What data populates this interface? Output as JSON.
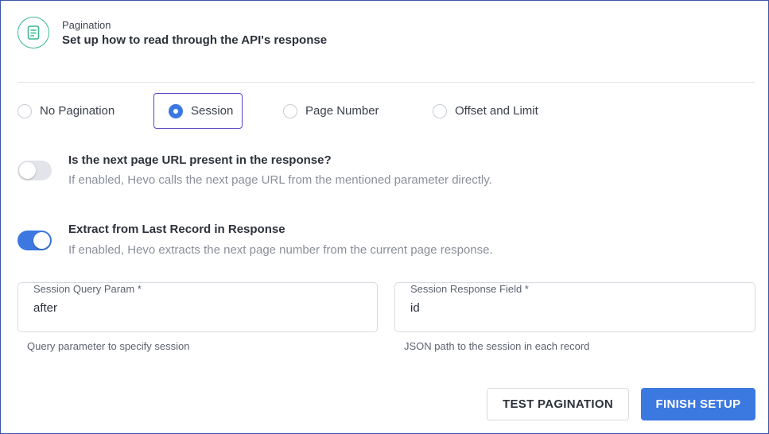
{
  "header": {
    "kicker": "Pagination",
    "title": "Set up how to read through the API's response",
    "icon": "document-icon",
    "icon_color": "#39b88f"
  },
  "pagination_options": [
    {
      "label": "No Pagination",
      "selected": false
    },
    {
      "label": "Session",
      "selected": true
    },
    {
      "label": "Page Number",
      "selected": false
    },
    {
      "label": "Offset and Limit",
      "selected": false
    }
  ],
  "toggles": [
    {
      "title": "Is the next page URL present in the response?",
      "description": "If enabled, Hevo calls the next page URL from the mentioned parameter directly.",
      "on": false
    },
    {
      "title": "Extract from Last Record in Response",
      "description": "If enabled, Hevo extracts the next page number from the current page response.",
      "on": true
    }
  ],
  "fields": [
    {
      "label": "Session Query Param *",
      "value": "after",
      "hint": "Query parameter to specify session"
    },
    {
      "label": "Session Response Field *",
      "value": "id",
      "hint": "JSON path to the session in each record"
    }
  ],
  "buttons": {
    "test_label": "TEST PAGINATION",
    "finish_label": "FINISH SETUP"
  },
  "colors": {
    "accent": "#3b78e0",
    "selected_border": "#5a43c8",
    "frame_border": "#3a57a8"
  }
}
